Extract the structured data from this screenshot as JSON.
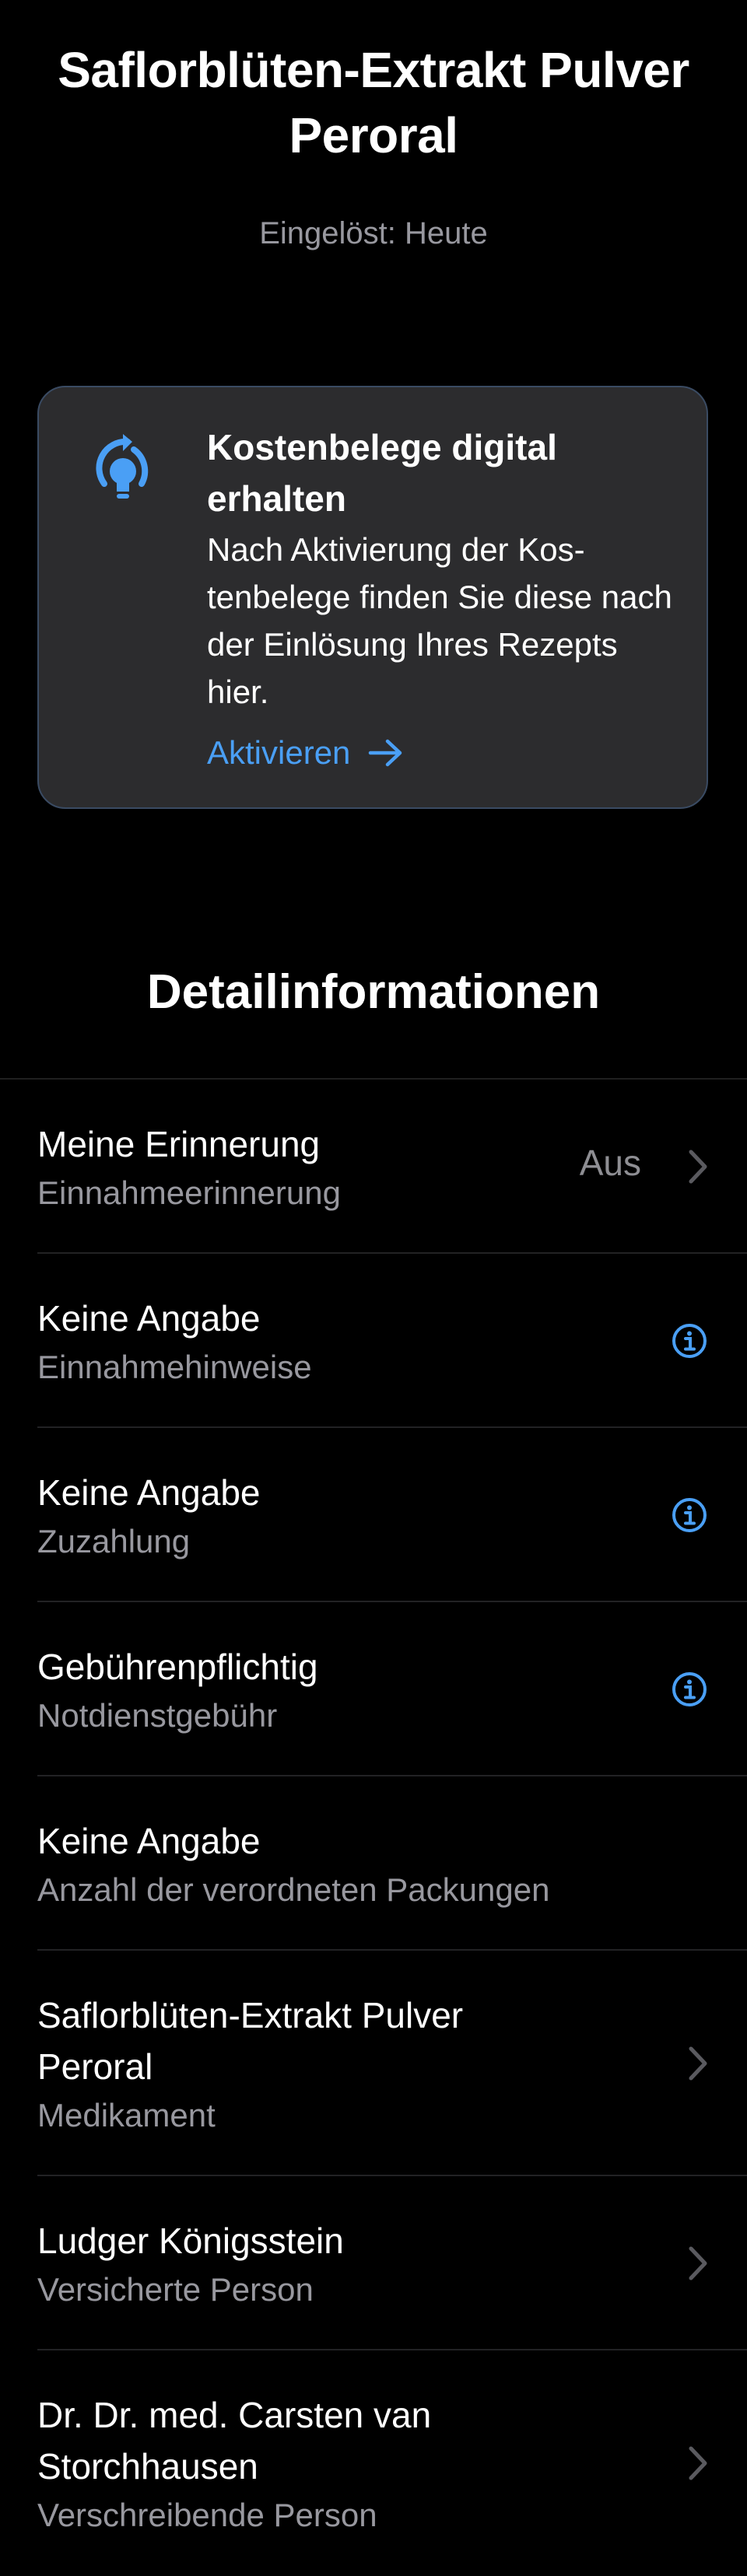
{
  "header": {
    "title": "Saflorblüten-Extrakt Pulver Peroral",
    "subtitle": "Eingelöst: Heute"
  },
  "card": {
    "icon": "lightbulb-refresh-icon",
    "title": "Kostenbelege digital erhalten",
    "text": "Nach Aktivierung der Kos-tenbelege finden Sie diese nach der Einlösung Ihres Rezepts hier.",
    "link_label": "Aktivieren",
    "link_icon": "arrow-right-icon"
  },
  "details": {
    "title": "Detailinformationen",
    "rows": [
      {
        "main": "Meine Erinnerung",
        "sub": "Einnahmeerinnerung",
        "value": "Aus",
        "accessory": "chevron"
      },
      {
        "main": "Keine Angabe",
        "sub": "Einnahmehinweise",
        "accessory": "info"
      },
      {
        "main": "Keine Angabe",
        "sub": "Zuzahlung",
        "accessory": "info"
      },
      {
        "main": "Gebührenpflichtig",
        "sub": "Notdienstgebühr",
        "accessory": "info"
      },
      {
        "main": "Keine Angabe",
        "sub": "Anzahl der verordneten Packungen",
        "accessory": "none"
      },
      {
        "main": "Saflorblüten-Extrakt Pulver Peroral",
        "sub": "Medikament",
        "accessory": "chevron"
      },
      {
        "main": "Ludger Königsstein",
        "sub": "Versicherte Person",
        "accessory": "chevron"
      },
      {
        "main": "Dr. Dr. med. Carsten van Storchhausen",
        "sub": "Verschreibende Person",
        "accessory": "chevron"
      }
    ]
  },
  "colors": {
    "background": "#000000",
    "card_background": "#2c2c2e",
    "accent": "#4a9ff5",
    "secondary_text": "#98989f"
  }
}
